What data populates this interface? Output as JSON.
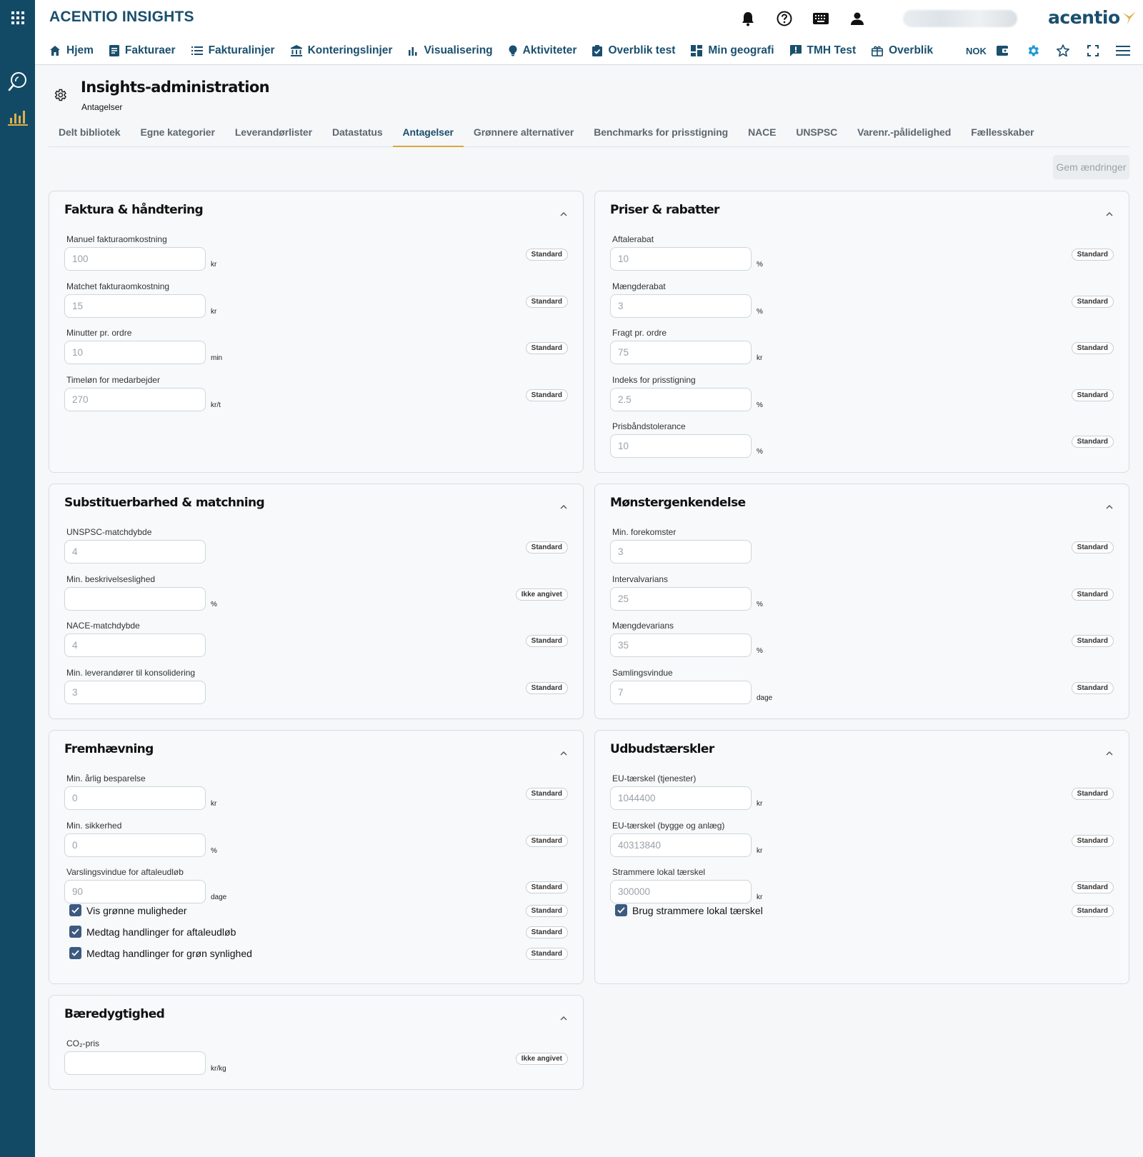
{
  "app": {
    "title": "ACENTIO INSIGHTS",
    "logo_text": "acentio"
  },
  "rail": {
    "icons": [
      "apps-grid-icon",
      "search-explore-icon",
      "bar-chart-icon"
    ]
  },
  "top_icons": [
    "bell-icon",
    "help-icon",
    "keyboard-icon",
    "user-icon"
  ],
  "nav": {
    "items": [
      {
        "label": "Hjem",
        "icon": "home-icon"
      },
      {
        "label": "Fakturaer",
        "icon": "document-icon"
      },
      {
        "label": "Fakturalinjer",
        "icon": "list-icon"
      },
      {
        "label": "Konteringslinjer",
        "icon": "bank-icon"
      },
      {
        "label": "Visualisering",
        "icon": "bar-chart-icon"
      },
      {
        "label": "Aktiviteter",
        "icon": "lightbulb-icon"
      },
      {
        "label": "Overblik test",
        "icon": "clipboard-check-icon"
      },
      {
        "label": "Min geografi",
        "icon": "dashboard-icon"
      },
      {
        "label": "TMH Test",
        "icon": "feedback-icon"
      },
      {
        "label": "Overblik",
        "icon": "gift-icon"
      }
    ],
    "currency": "NOK"
  },
  "page": {
    "title": "Insights-administration",
    "subtitle": "Antagelser"
  },
  "tabs": [
    {
      "label": "Delt bibliotek",
      "active": false
    },
    {
      "label": "Egne kategorier",
      "active": false
    },
    {
      "label": "Leverandørlister",
      "active": false
    },
    {
      "label": "Datastatus",
      "active": false
    },
    {
      "label": "Antagelser",
      "active": true
    },
    {
      "label": "Grønnere alternativer",
      "active": false
    },
    {
      "label": "Benchmarks for prisstigning",
      "active": false
    },
    {
      "label": "NACE",
      "active": false
    },
    {
      "label": "UNSPSC",
      "active": false
    },
    {
      "label": "Varenr.-pålidelighed",
      "active": false
    },
    {
      "label": "Fællesskaber",
      "active": false
    }
  ],
  "save_label": "Gem ændringer",
  "cards": [
    {
      "title": "Faktura & håndtering",
      "fields": [
        {
          "label": "Manuel fakturaomkostning",
          "value": "100",
          "unit": "kr",
          "badge": "Standard"
        },
        {
          "label": "Matchet fakturaomkostning",
          "value": "15",
          "unit": "kr",
          "badge": "Standard"
        },
        {
          "label": "Minutter pr. ordre",
          "value": "10",
          "unit": "min",
          "badge": "Standard"
        },
        {
          "label": "Timeløn for medarbejder",
          "value": "270",
          "unit": "kr/t",
          "badge": "Standard"
        }
      ],
      "checks": []
    },
    {
      "title": "Priser & rabatter",
      "fields": [
        {
          "label": "Aftalerabat",
          "value": "10",
          "unit": "%",
          "badge": "Standard"
        },
        {
          "label": "Mængderabat",
          "value": "3",
          "unit": "%",
          "badge": "Standard"
        },
        {
          "label": "Fragt pr. ordre",
          "value": "75",
          "unit": "kr",
          "badge": "Standard"
        },
        {
          "label": "Indeks for prisstigning",
          "value": "2.5",
          "unit": "%",
          "badge": "Standard"
        },
        {
          "label": "Prisbåndstolerance",
          "value": "10",
          "unit": "%",
          "badge": "Standard"
        }
      ],
      "checks": []
    },
    {
      "title": "Substituerbarhed & matchning",
      "fields": [
        {
          "label": "UNSPSC-matchdybde",
          "value": "4",
          "unit": "",
          "badge": "Standard"
        },
        {
          "label": "Min. beskrivelseslighed",
          "value": "",
          "unit": "%",
          "badge": "Ikke angivet"
        },
        {
          "label": "NACE-matchdybde",
          "value": "4",
          "unit": "",
          "badge": "Standard"
        },
        {
          "label": "Min. leverandører til konsolidering",
          "value": "3",
          "unit": "",
          "badge": "Standard"
        }
      ],
      "checks": []
    },
    {
      "title": "Mønstergenkendelse",
      "fields": [
        {
          "label": "Min. forekomster",
          "value": "3",
          "unit": "",
          "badge": "Standard"
        },
        {
          "label": "Intervalvarians",
          "value": "25",
          "unit": "%",
          "badge": "Standard"
        },
        {
          "label": "Mængdevarians",
          "value": "35",
          "unit": "%",
          "badge": "Standard"
        },
        {
          "label": "Samlingsvindue",
          "value": "7",
          "unit": "dage",
          "badge": "Standard"
        }
      ],
      "checks": []
    },
    {
      "title": "Fremhævning",
      "fields": [
        {
          "label": "Min. årlig besparelse",
          "value": "0",
          "unit": "kr",
          "badge": "Standard"
        },
        {
          "label": "Min. sikkerhed",
          "value": "0",
          "unit": "%",
          "badge": "Standard"
        },
        {
          "label": "Varslingsvindue for aftaleudløb",
          "value": "90",
          "unit": "dage",
          "badge": "Standard"
        }
      ],
      "checks": [
        {
          "label": "Vis grønne muligheder",
          "checked": true,
          "badge": "Standard"
        },
        {
          "label": "Medtag handlinger for aftaleudløb",
          "checked": true,
          "badge": "Standard"
        },
        {
          "label": "Medtag handlinger for grøn synlighed",
          "checked": true,
          "badge": "Standard"
        }
      ]
    },
    {
      "title": "Udbudstærskler",
      "fields": [
        {
          "label": "EU-tærskel (tjenester)",
          "value": "1044400",
          "unit": "kr",
          "badge": "Standard"
        },
        {
          "label": "EU-tærskel (bygge og anlæg)",
          "value": "40313840",
          "unit": "kr",
          "badge": "Standard"
        },
        {
          "label": "Strammere lokal tærskel",
          "value": "300000",
          "unit": "kr",
          "badge": "Standard"
        }
      ],
      "checks": [
        {
          "label": "Brug strammere lokal tærskel",
          "checked": true,
          "badge": "Standard"
        }
      ]
    },
    {
      "title": "Bæredygtighed",
      "fields": [
        {
          "label": "CO₂-pris",
          "value": "",
          "unit": "kr/kg",
          "badge": "Ikke angivet"
        }
      ],
      "checks": []
    }
  ]
}
